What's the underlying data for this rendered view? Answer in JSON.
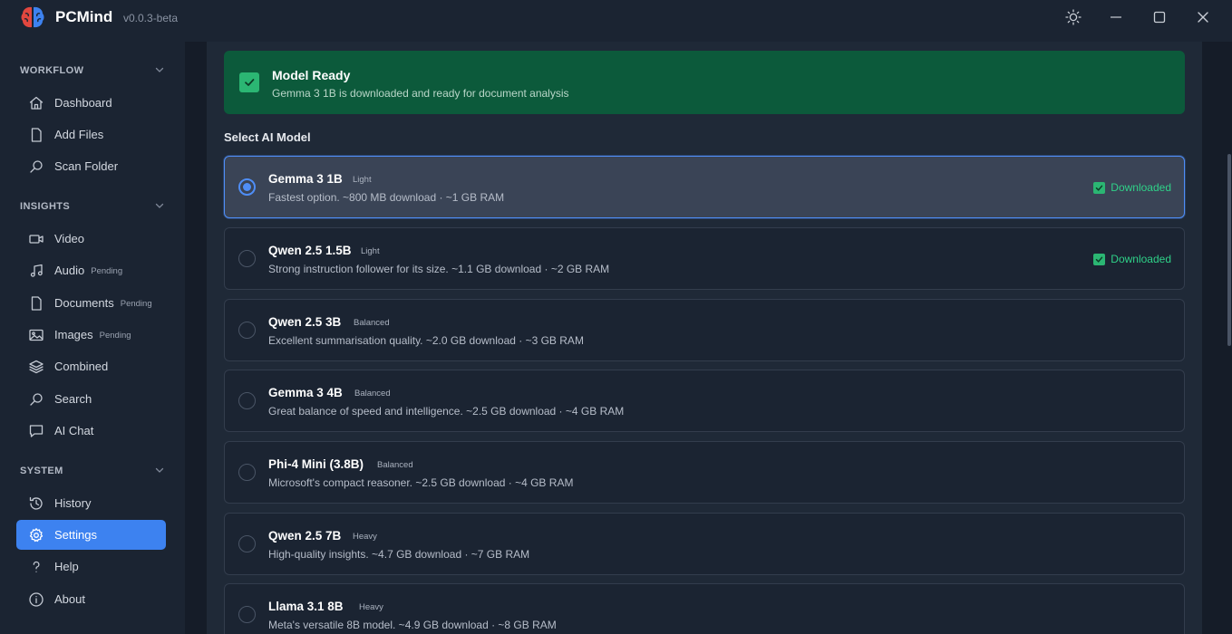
{
  "app": {
    "name": "PCMind",
    "version": "v0.0.3-beta"
  },
  "sidebar": {
    "sections": [
      {
        "title": "WORKFLOW",
        "items": [
          {
            "label": "Dashboard",
            "icon": "home-icon"
          },
          {
            "label": "Add Files",
            "icon": "file-icon"
          },
          {
            "label": "Scan Folder",
            "icon": "search-icon"
          }
        ]
      },
      {
        "title": "INSIGHTS",
        "items": [
          {
            "label": "Video",
            "icon": "video-icon"
          },
          {
            "label": "Audio",
            "icon": "music-icon",
            "badge": "Pending"
          },
          {
            "label": "Documents",
            "icon": "file-icon",
            "badge": "Pending"
          },
          {
            "label": "Images",
            "icon": "image-icon",
            "badge": "Pending"
          },
          {
            "label": "Combined",
            "icon": "layers-icon"
          },
          {
            "label": "Search",
            "icon": "search-icon"
          },
          {
            "label": "AI Chat",
            "icon": "chat-icon"
          }
        ]
      },
      {
        "title": "SYSTEM",
        "items": [
          {
            "label": "History",
            "icon": "history-icon"
          },
          {
            "label": "Settings",
            "icon": "gear-icon",
            "active": true
          },
          {
            "label": "Help",
            "icon": "help-icon"
          },
          {
            "label": "About",
            "icon": "info-icon"
          }
        ]
      }
    ]
  },
  "banner": {
    "title": "Model Ready",
    "subtitle": "Gemma 3 1B is downloaded and ready for document analysis"
  },
  "select_label": "Select AI Model",
  "models": [
    {
      "name": "Gemma 3 1B",
      "tag": "Light",
      "desc": "Fastest option. ~800 MB download · ~1 GB RAM",
      "status": "Downloaded",
      "selected": true
    },
    {
      "name": "Qwen 2.5 1.5B",
      "tag": "Light",
      "desc": "Strong instruction follower for its size. ~1.1 GB download · ~2 GB RAM",
      "status": "Downloaded",
      "selected": false
    },
    {
      "name": "Qwen 2.5 3B",
      "tag": "Balanced",
      "desc": "Excellent summarisation quality. ~2.0 GB download · ~3 GB RAM",
      "status": "",
      "selected": false
    },
    {
      "name": "Gemma 3 4B",
      "tag": "Balanced",
      "desc": "Great balance of speed and intelligence. ~2.5 GB download · ~4 GB RAM",
      "status": "",
      "selected": false
    },
    {
      "name": "Phi-4 Mini (3.8B)",
      "tag": "Balanced",
      "desc": "Microsoft's compact reasoner. ~2.5 GB download · ~4 GB RAM",
      "status": "",
      "selected": false
    },
    {
      "name": "Qwen 2.5 7B",
      "tag": "Heavy",
      "desc": "High-quality insights. ~4.7 GB download · ~7 GB RAM",
      "status": "",
      "selected": false
    },
    {
      "name": "Llama 3.1 8B",
      "tag": "Heavy",
      "desc": "Meta's versatile 8B model. ~4.9 GB download · ~8 GB RAM",
      "status": "",
      "selected": false
    }
  ],
  "colors": {
    "accent": "#3d82f0",
    "success": "#2bb673",
    "banner_bg": "#0c5a3b"
  }
}
